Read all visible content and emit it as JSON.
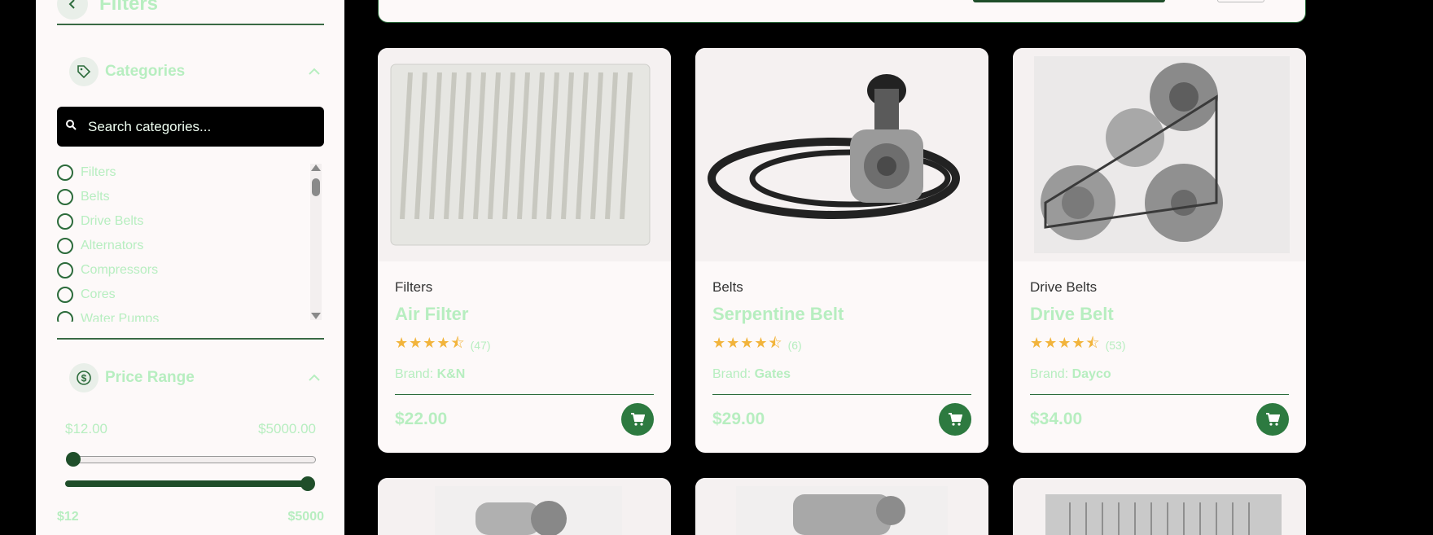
{
  "sidebar": {
    "title": "Filters",
    "categories": {
      "title": "Categories",
      "search_placeholder": "Search categories...",
      "items": [
        {
          "label": "Filters"
        },
        {
          "label": "Belts"
        },
        {
          "label": "Drive Belts"
        },
        {
          "label": "Alternators"
        },
        {
          "label": "Compressors"
        },
        {
          "label": "Cores"
        },
        {
          "label": "Water Pumps"
        }
      ]
    },
    "price_range": {
      "title": "Price Range",
      "min_display": "$12.00",
      "max_display": "$5000.00",
      "min_label": "$12",
      "max_label": "$5000"
    }
  },
  "products": [
    {
      "category": "Filters",
      "name": "Air Filter",
      "rating": 4.5,
      "stars": "★★★★⯪",
      "reviews": "(47)",
      "brand_label": "Brand:",
      "brand": "K&N",
      "price": "$22.00"
    },
    {
      "category": "Belts",
      "name": "Serpentine Belt",
      "rating": 4.5,
      "stars": "★★★★⯪",
      "reviews": "(6)",
      "brand_label": "Brand:",
      "brand": "Gates",
      "price": "$29.00"
    },
    {
      "category": "Drive Belts",
      "name": "Drive Belt",
      "rating": 4.5,
      "stars": "★★★★⯪",
      "reviews": "(53)",
      "brand_label": "Brand:",
      "brand": "Dayco",
      "price": "$34.00"
    }
  ],
  "colors": {
    "accent": "#2d7a40",
    "dark": "#1f4e2a",
    "light_text": "#b7eec0",
    "star": "#f2b43c"
  }
}
